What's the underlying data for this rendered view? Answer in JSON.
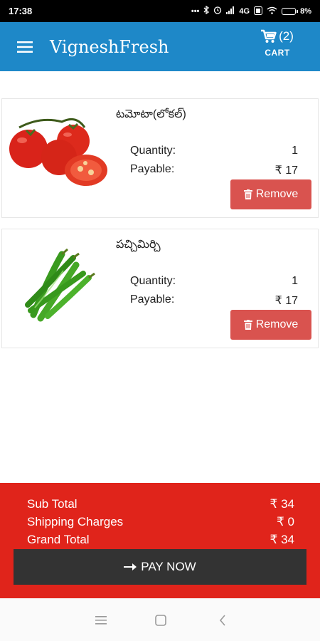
{
  "status_bar": {
    "time": "17:38",
    "network": "4G",
    "battery": "8%"
  },
  "appbar": {
    "title": "VigneshFresh",
    "cart_count": "(2)",
    "cart_label": "CART"
  },
  "items": [
    {
      "name": "టమోటా(లోకల్)",
      "quantity_label": "Quantity:",
      "quantity": "1",
      "payable_label": "Payable:",
      "payable": "₹ 17",
      "remove_label": "Remove",
      "image_icon": "tomato-image"
    },
    {
      "name": "పచ్చిమిర్చి",
      "quantity_label": "Quantity:",
      "quantity": "1",
      "payable_label": "Payable:",
      "payable": "₹ 17",
      "remove_label": "Remove",
      "image_icon": "green-chilli-image"
    }
  ],
  "summary": {
    "sub_total_label": "Sub Total",
    "sub_total": "₹ 34",
    "shipping_label": "Shipping Charges",
    "shipping": "₹ 0",
    "grand_total_label": "Grand Total",
    "grand_total": "₹ 34",
    "pay_label": "PAY NOW"
  },
  "colors": {
    "appbar": "#1e88c8",
    "remove": "#d9534f",
    "summary": "#e0241b",
    "pay_button": "#333333"
  }
}
